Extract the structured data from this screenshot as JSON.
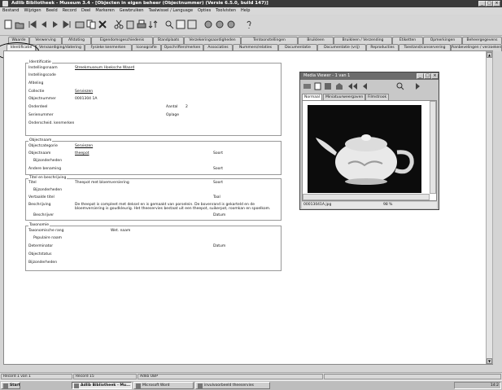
{
  "window": {
    "title": "Adlib Bibliotheek - Museum 3.4 - [Objecten in eigen beheer (Objectnummer) (Versie 6.5.0, build 147)]",
    "min": "_",
    "max": "□",
    "close": "×"
  },
  "menu": [
    "Bestand",
    "Wijzigen",
    "Beeld",
    "Record",
    "Deel",
    "Markeren",
    "Gewbruiken",
    "Taalwissel / Language",
    "Opties",
    "Toolvisten",
    "Help"
  ],
  "toolbar_icons": [
    "new-icon",
    "open-icon",
    "first-record-icon",
    "prev-record-icon",
    "next-record-icon",
    "last-record-icon",
    "edit-icon",
    "copy-icon",
    "delete-icon",
    "cut-icon",
    "paste-icon",
    "print-icon",
    "sort-icon",
    "search-icon",
    "link-icon",
    "field-icon",
    "list-icon",
    "report-icon",
    "settings-icon",
    "help-icon"
  ],
  "tabs_row1": [
    "Waarde",
    "Verwerving",
    "Afstoting",
    "Eigendomsgeschiedenis",
    "Standplaats",
    "Verzekeringsaardigheden",
    "Tentoonstellingen",
    "Bruikleen",
    "Bruikleen / Verzending",
    "Etiketten",
    "Opmerkingen",
    "Beheergegevens"
  ],
  "tabs_row2": [
    "Identificatie",
    "Vervaardiging/datering",
    "Fysieke kenmerken",
    "Iconografie",
    "Opschriften/merken",
    "Associaties",
    "Nummers/relaties",
    "Documentatie",
    "Documentatie (vrij)",
    "Reproducties",
    "Toestand/conservering",
    "Aanbevelingen / verzoeken"
  ],
  "groups": {
    "identificatie": {
      "title": "Identificatie",
      "rows": [
        {
          "label": "Instellingsnaam",
          "value": "Streekmuseum Hoeksche Waard",
          "link": true
        },
        {
          "label": "Instellingscode",
          "value": ""
        },
        {
          "label": "Afdeling",
          "value": ""
        },
        {
          "label": "Collectie",
          "value": "Serviezen",
          "link": true
        },
        {
          "label": "Objectnummer",
          "value": "0001304 1A"
        },
        {
          "label": "Onderdeel",
          "value": ""
        },
        {
          "label": "Serienummer",
          "value": ""
        },
        {
          "label": "Onderscheid. kenmerken",
          "value": ""
        }
      ],
      "aantal_label": "Aantal",
      "aantal_value": "2",
      "oplage_label": "Oplage"
    },
    "objectnaam": {
      "title": "Objectnaam",
      "rows": [
        {
          "label": "Objectcategorie",
          "value": "Serviezen",
          "link": true
        },
        {
          "label": "Objectnaam",
          "value": "theepot",
          "link": true
        },
        {
          "label": "Bijzonderheden",
          "value": ""
        },
        {
          "label": "Andere benaming",
          "value": ""
        }
      ],
      "soort1": "Soort",
      "soort2": "Soort"
    },
    "titel": {
      "title": "Titel en beschrijving",
      "rows": [
        {
          "label": "Titel",
          "value": "Theepot met bloemversiering"
        },
        {
          "label": "Bijzonderheden",
          "value": ""
        },
        {
          "label": "Vertaalde titel",
          "value": ""
        },
        {
          "label": "Beschrijving",
          "value": "De theepot is compleet met deksel en is gemaakt van porselein. De bovenrand is gekarteld en de bloemversiering is goudkleurig. Het theeservies bestaat uit een theepot, suikerpot, roomkan en spoelkom."
        },
        {
          "label": "Beschrijver",
          "value": ""
        }
      ],
      "soort": "Soort",
      "taal": "Taal",
      "datum": "Datum"
    },
    "taxonomie": {
      "title": "Taxonomie",
      "rows": [
        {
          "label": "Taxonomische rang",
          "value": ""
        },
        {
          "label": "Populaire naam",
          "value": ""
        },
        {
          "label": "Determinator",
          "value": ""
        },
        {
          "label": "Objectstatus",
          "value": ""
        },
        {
          "label": "Bijzonderheden",
          "value": ""
        }
      ],
      "wet_naam": "Wet. naam",
      "datum": "Datum"
    }
  },
  "media_viewer": {
    "title": "Media Viewer - 1 van 1",
    "tabs": [
      "Normaal",
      "Miniatuurweergaven",
      "Filmstrook"
    ],
    "active_tab": "Normaal",
    "filename": "00013041A.jpg",
    "zoom": "98 %",
    "icons": [
      "print-icon",
      "copy-icon",
      "save-icon",
      "home-icon",
      "first-icon",
      "prev-icon",
      "zoom-icon",
      "next-icon"
    ]
  },
  "status": {
    "record": "Record 1 van 1",
    "record_no": "Record 15",
    "mode": "Adlib OBP"
  },
  "taskbar": {
    "start": "Start",
    "tasks": [
      "Adlib Bibliotheek - Mu...",
      "Microsoft Word",
      "invulvoorbeeld theeservies"
    ],
    "clock": "14:2"
  }
}
